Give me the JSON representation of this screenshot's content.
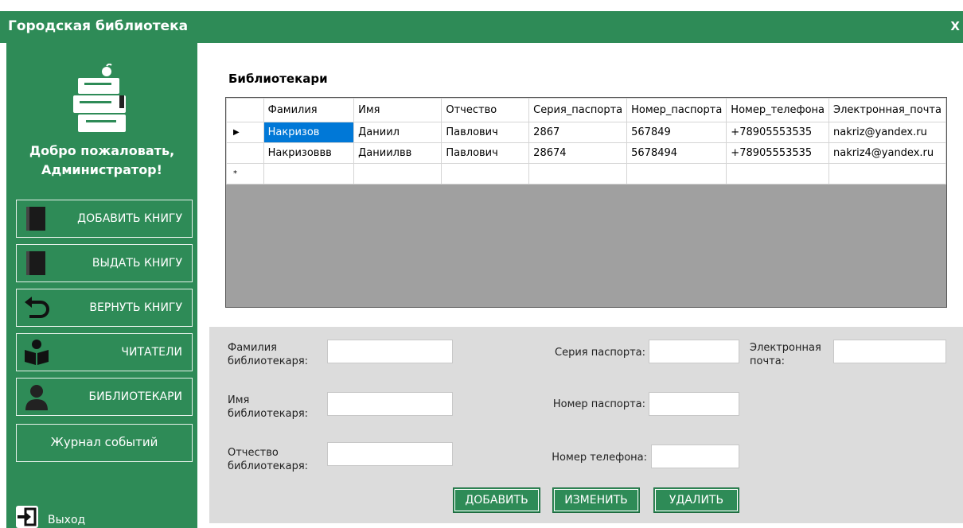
{
  "window": {
    "title": "Городская библиотека",
    "close_label": "X"
  },
  "sidebar": {
    "welcome": "Добро пожаловать, Администратор!",
    "menu": [
      {
        "label": "ДОБАВИТЬ КНИГУ",
        "icon": "book-icon"
      },
      {
        "label": "ВЫДАТЬ КНИГУ",
        "icon": "book-icon"
      },
      {
        "label": "ВЕРНУТЬ КНИГУ",
        "icon": "return-arrow-icon"
      },
      {
        "label": "ЧИТАТЕЛИ",
        "icon": "reader-icon"
      },
      {
        "label": "БИБЛИОТЕКАРИ",
        "icon": "user-icon"
      },
      {
        "label": "Журнал событий"
      }
    ],
    "exit_label": "Выход"
  },
  "main": {
    "heading": "Библиотекари",
    "table": {
      "columns": [
        "Фамилия",
        "Имя",
        "Отчество",
        "Серия_паспорта",
        "Номер_паспорта",
        "Номер_телефона",
        "Электронная_почта"
      ],
      "rows": [
        [
          "Накризов",
          "Даниил",
          "Павлович",
          "2867",
          "567849",
          "+78905553535",
          "nakriz@yandex.ru"
        ],
        [
          "Накризоввв",
          "Даниилвв",
          "Павлович",
          "28674",
          "5678494",
          "+78905553535",
          "nakriz4@yandex.ru"
        ]
      ],
      "current_row_marker": "▶",
      "new_row_marker": "*"
    }
  },
  "form": {
    "surname_label": "Фамилия библиотекаря:",
    "name_label": "Имя библиотекаря:",
    "patronymic_label": "Отчество библиотекаря:",
    "passport_series_label": "Серия паспорта:",
    "passport_number_label": "Номер паспорта:",
    "phone_label": "Номер телефона:",
    "email_label": "Электронная почта:",
    "add_label": "ДОБАВИТЬ",
    "edit_label": "ИЗМЕНИТЬ",
    "delete_label": "УДАЛИТЬ"
  },
  "colors": {
    "accent": "#2e8b57",
    "selection": "#0078d7",
    "panel": "#dcdcdc"
  }
}
